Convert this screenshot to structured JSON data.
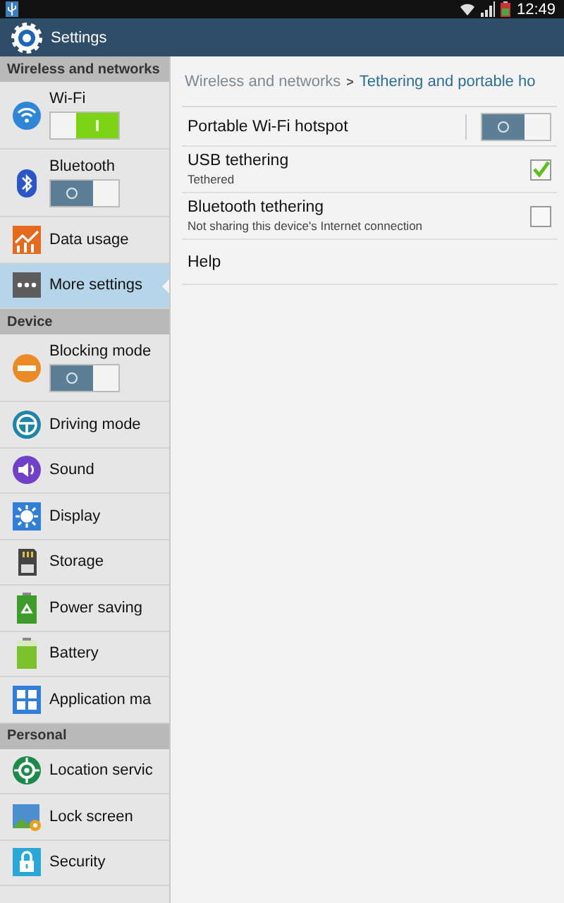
{
  "status_bar": {
    "time": "12:49"
  },
  "action_bar": {
    "title": "Settings"
  },
  "sidebar": {
    "sections": [
      {
        "title": "Wireless and networks",
        "items": [
          {
            "label": "Wi-Fi",
            "kind": "toggle",
            "on": true,
            "selected": false
          },
          {
            "label": "Bluetooth",
            "kind": "toggle",
            "on": false,
            "selected": false
          },
          {
            "label": "Data usage",
            "kind": "plain",
            "selected": false
          },
          {
            "label": "More settings",
            "kind": "plain",
            "selected": true
          }
        ]
      },
      {
        "title": "Device",
        "items": [
          {
            "label": "Blocking mode",
            "kind": "toggle",
            "on": false,
            "selected": false
          },
          {
            "label": "Driving mode",
            "kind": "plain",
            "selected": false
          },
          {
            "label": "Sound",
            "kind": "plain",
            "selected": false
          },
          {
            "label": "Display",
            "kind": "plain",
            "selected": false
          },
          {
            "label": "Storage",
            "kind": "plain",
            "selected": false
          },
          {
            "label": "Power saving",
            "kind": "plain",
            "selected": false
          },
          {
            "label": "Battery",
            "kind": "plain",
            "selected": false
          },
          {
            "label": "Application ma",
            "kind": "plain",
            "selected": false
          }
        ]
      },
      {
        "title": "Personal",
        "items": [
          {
            "label": "Location servic",
            "kind": "plain",
            "selected": false
          },
          {
            "label": "Lock screen",
            "kind": "plain",
            "selected": false
          },
          {
            "label": "Security",
            "kind": "plain",
            "selected": false
          }
        ]
      }
    ]
  },
  "detail": {
    "breadcrumb": {
      "parent": "Wireless and networks",
      "separator": ">",
      "current": "Tethering and portable ho"
    },
    "rows": [
      {
        "title": "Portable Wi-Fi hotspot",
        "kind": "switch",
        "on": false
      },
      {
        "title": "USB tethering",
        "summary": "Tethered",
        "kind": "checkbox",
        "checked": true
      },
      {
        "title": "Bluetooth tethering",
        "summary": "Not sharing this device's Internet connection",
        "kind": "checkbox",
        "checked": false
      },
      {
        "title": "Help",
        "kind": "plain"
      }
    ]
  }
}
